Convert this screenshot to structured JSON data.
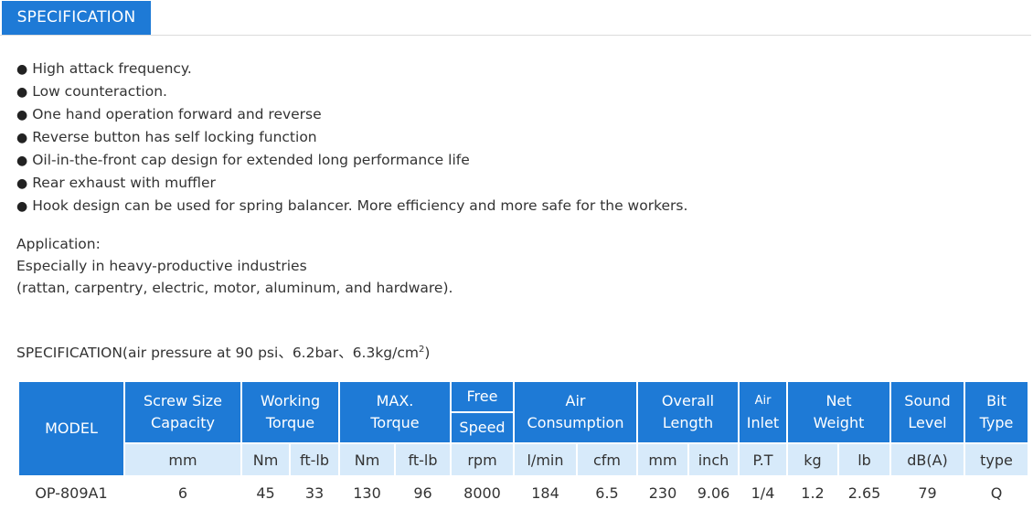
{
  "tab": {
    "label": "SPECIFICATION"
  },
  "features": [
    "High attack frequency.",
    "Low counteraction.",
    "One hand operation forward and reverse",
    "Reverse button has self locking function",
    "Oil-in-the-front cap design for extended long performance life",
    "Rear exhaust with muffler",
    "Hook design can be used for spring balancer. More efficiency and more safe for the workers."
  ],
  "bullet_glyph": "●",
  "application": {
    "heading": "Application:",
    "line1": "Especially in heavy-productive industries",
    "line2": "(rattan, carpentry, electric, motor, aluminum, and hardware)."
  },
  "spec_note": {
    "text": "SPECIFICATION(air pressure at 90 psi、6.2bar、6.3kg/cm",
    "sup": "2",
    "suffix": ")"
  },
  "table": {
    "headers": {
      "model": "MODEL",
      "screw_l1": "Screw Size",
      "screw_l2": "Capacity",
      "working_l1": "Working",
      "working_l2": "Torque",
      "max_l1": "MAX.",
      "max_l2": "Torque",
      "free_l1": "Free",
      "free_l2": "Speed",
      "air_l1": "Air",
      "air_l2": "Consumption",
      "overall_l1": "Overall",
      "overall_l2": "Length",
      "inlet_l1": "Air",
      "inlet_l2": "Inlet",
      "net_l1": "Net",
      "net_l2": "Weight",
      "sound_l1": "Sound",
      "sound_l2": "Level",
      "bit_l1": "Bit",
      "bit_l2": "Type"
    },
    "units": [
      "mm",
      "Nm",
      "ft-lb",
      "Nm",
      "ft-lb",
      "rpm",
      "l/min",
      "cfm",
      "mm",
      "inch",
      "P.T",
      "kg",
      "lb",
      "dB(A)",
      "type"
    ],
    "row": {
      "model": "OP-809A1",
      "values": [
        "6",
        "45",
        "33",
        "130",
        "96",
        "8000",
        "184",
        "6.5",
        "230",
        "9.06",
        "1/4",
        "1.2",
        "2.65",
        "79",
        "Q"
      ]
    }
  },
  "colors": {
    "accent": "#1e7ad6",
    "unit_row": "#d7eafa",
    "bit_type": "#d62828"
  }
}
